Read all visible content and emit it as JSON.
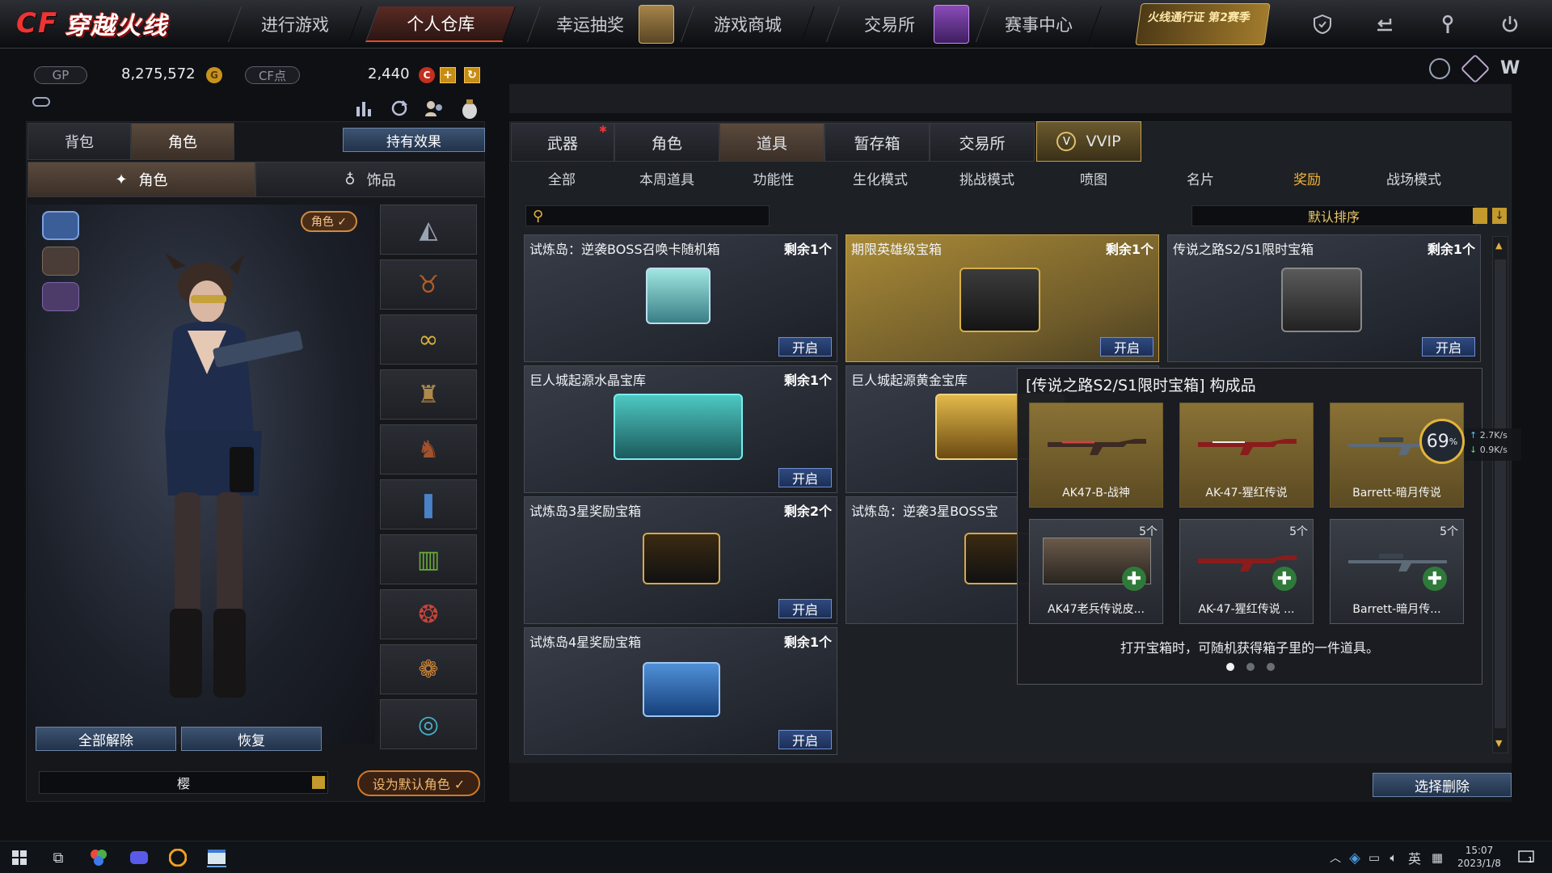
{
  "app": {
    "logo_text": "穿越火线",
    "logo_cf": "CF"
  },
  "nav": {
    "items": [
      {
        "label": "进行游戏"
      },
      {
        "label": "个人仓库"
      },
      {
        "label": "幸运抽奖"
      },
      {
        "label": "游戏商城"
      },
      {
        "label": "交易所"
      },
      {
        "label": "赛事中心"
      }
    ],
    "pass_badge": "火线通行证 第2赛季",
    "icons": [
      "shield-icon",
      "exit-icon",
      "tools-icon",
      "power-icon"
    ]
  },
  "currency": {
    "gp_label": "GP",
    "gp_value": "8,275,572",
    "cf_label": "CF点",
    "cf_value": "2,440",
    "add_symbol": "+",
    "refresh_symbol": "↻"
  },
  "left": {
    "tabs": [
      {
        "label": "背包"
      },
      {
        "label": "角色"
      }
    ],
    "effects_button": "持有效果",
    "subtabs": [
      {
        "label": "角色"
      },
      {
        "label": "饰品"
      }
    ],
    "role_badge": "角色 ✓",
    "unequip_all": "全部解除",
    "restore": "恢复",
    "character_name": "樱",
    "set_default": "设为默认角色 ✓"
  },
  "right": {
    "tabs": [
      {
        "label": "武器"
      },
      {
        "label": "角色"
      },
      {
        "label": "道具"
      },
      {
        "label": "暂存箱"
      },
      {
        "label": "交易所"
      },
      {
        "label": "VVIP"
      }
    ],
    "subtabs": [
      {
        "label": "全部"
      },
      {
        "label": "本周道具"
      },
      {
        "label": "功能性"
      },
      {
        "label": "生化模式"
      },
      {
        "label": "挑战模式"
      },
      {
        "label": "喷图"
      },
      {
        "label": "名片"
      },
      {
        "label": "奖励"
      },
      {
        "label": "战场模式"
      }
    ],
    "search_placeholder": "",
    "sort_label": "默认排序",
    "open_label": "开启",
    "cards": [
      {
        "title": "试炼岛：逆袭BOSS召唤卡随机箱",
        "remain": "剩余1个"
      },
      {
        "title": "期限英雄级宝箱",
        "remain": "剩余1个"
      },
      {
        "title": "传说之路S2/S1限时宝箱",
        "remain": "剩余1个"
      },
      {
        "title": "巨人城起源水晶宝库",
        "remain": "剩余1个"
      },
      {
        "title": "巨人城起源黄金宝库",
        "remain": ""
      },
      {
        "title": "试炼岛3星奖励宝箱",
        "remain": "剩余2个"
      },
      {
        "title": "试炼岛：逆袭3星BOSS宝",
        "remain": ""
      },
      {
        "title": "试炼岛4星奖励宝箱",
        "remain": "剩余1个"
      }
    ],
    "delete_button": "选择删除"
  },
  "popup": {
    "title": "[传说之路S2/S1限时宝箱] 构成品",
    "items": [
      {
        "name": "AK47-B-战神",
        "count": ""
      },
      {
        "name": "AK-47-猩红传说",
        "count": ""
      },
      {
        "name": "Barrett-暗月传说",
        "count": ""
      },
      {
        "name": "AK47老兵传说皮...",
        "count": "5个"
      },
      {
        "name": "AK-47-猩红传说 ...",
        "count": "5个"
      },
      {
        "name": "Barrett-暗月传...",
        "count": "5个"
      }
    ],
    "hint": "打开宝箱时，可随机获得箱子里的一件道具。",
    "page_dots": 3,
    "active_dot": 0
  },
  "net_widget": {
    "percent": "69",
    "percent_unit": "%",
    "up": "2.7K/s",
    "down": "0.9K/s"
  },
  "taskbar": {
    "time": "15:07",
    "date": "2023/1/8",
    "lang": "英",
    "notif_count": "1"
  },
  "colors": {
    "accent_orange": "#f2b23a",
    "open_button_blue": "#2f4a80",
    "gold_card": "#a98a37"
  }
}
